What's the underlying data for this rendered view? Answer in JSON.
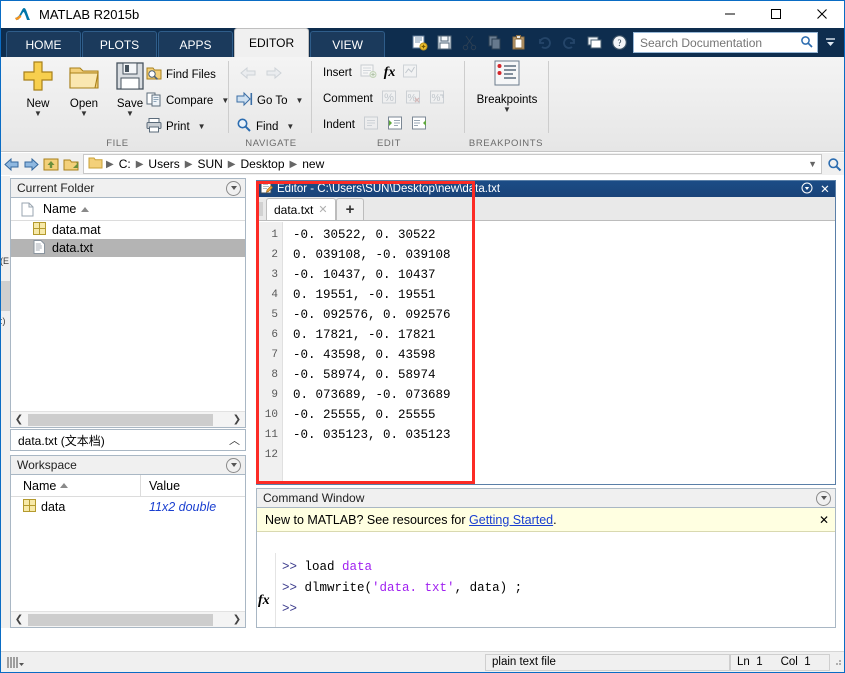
{
  "window": {
    "title": "MATLAB R2015b",
    "minimize": "—",
    "maximize": "☐",
    "close": "✕"
  },
  "ribbon": {
    "tabs": [
      {
        "label": "HOME",
        "active": false
      },
      {
        "label": "PLOTS",
        "active": false
      },
      {
        "label": "APPS",
        "active": false
      },
      {
        "label": "EDITOR",
        "active": true
      },
      {
        "label": "VIEW",
        "active": false
      }
    ],
    "quick_access": [
      {
        "name": "new-script-icon",
        "enabled": true
      },
      {
        "name": "save-icon",
        "enabled": true
      },
      {
        "name": "cut-icon",
        "enabled": false
      },
      {
        "name": "copy-icon",
        "enabled": false
      },
      {
        "name": "paste-icon",
        "enabled": true
      },
      {
        "name": "undo-icon",
        "enabled": false
      },
      {
        "name": "redo-icon",
        "enabled": false
      },
      {
        "name": "switch-window-icon",
        "enabled": true
      },
      {
        "name": "help-icon",
        "enabled": true
      }
    ],
    "search": {
      "placeholder": "Search Documentation",
      "value": ""
    },
    "groups": [
      {
        "name": "FILE",
        "label": "FILE",
        "big_buttons": [
          {
            "label": "New",
            "icon": "new-plus-icon",
            "has_caret": true
          },
          {
            "label": "Open",
            "icon": "open-folder-icon",
            "has_caret": true
          },
          {
            "label": "Save",
            "icon": "save-floppy-icon",
            "has_caret": true
          }
        ],
        "small_items": [
          {
            "label": "Find Files",
            "icon": "find-files-icon",
            "has_caret": false
          },
          {
            "label": "Compare",
            "icon": "compare-icon",
            "has_caret": true
          },
          {
            "label": "Print",
            "icon": "print-icon",
            "has_caret": true
          }
        ]
      },
      {
        "name": "NAVIGATE",
        "label": "NAVIGATE",
        "small_items": [
          {
            "label": "",
            "icon": "back-arrow-icon",
            "has_caret": false,
            "disabled": true
          },
          {
            "label": "",
            "icon": "forward-arrow-icon",
            "has_caret": false,
            "disabled": true
          },
          {
            "label": "Go To",
            "icon": "go-to-icon",
            "has_caret": true
          },
          {
            "label": "Find",
            "icon": "find-magnifier-icon",
            "has_caret": true
          }
        ]
      },
      {
        "name": "EDIT",
        "label": "EDIT",
        "rows": [
          {
            "label": "Insert",
            "icons": [
              "insert-icon",
              "function-fx-icon",
              "insert-block-icon"
            ]
          },
          {
            "label": "Comment",
            "icons": [
              "comment-percent-icon",
              "uncomment-icon",
              "wrap-comment-icon"
            ]
          },
          {
            "label": "Indent",
            "icons": [
              "indent-icon",
              "indent-right-icon",
              "indent-left-icon"
            ]
          }
        ]
      },
      {
        "name": "BREAKPOINTS",
        "label": "BREAKPOINTS",
        "big_buttons": [
          {
            "label": "Breakpoints",
            "icon": "breakpoints-icon",
            "has_caret": true
          }
        ]
      }
    ]
  },
  "addressbar": {
    "back": "back-arrow",
    "forward": "forward-arrow",
    "up": "up-folder",
    "browse": "browse-folder",
    "crumbs": [
      "C:",
      "Users",
      "SUN",
      "Desktop",
      "new"
    ],
    "dropdown": "▾",
    "search_icon": "search-magnifier"
  },
  "current_folder": {
    "title": "Current Folder",
    "columns": [
      "Name"
    ],
    "sort": "asc",
    "files": [
      {
        "name": "data.mat",
        "icon": "mat-file-icon",
        "selected": false
      },
      {
        "name": "data.txt",
        "icon": "txt-file-icon",
        "selected": true
      }
    ]
  },
  "details": {
    "label": "data.txt  (文本档)",
    "collapse": "⌃"
  },
  "workspace": {
    "title": "Workspace",
    "columns": [
      "Name",
      "Value"
    ],
    "rows": [
      {
        "name": "data",
        "value": "11x2 double",
        "icon": "matrix-icon"
      }
    ]
  },
  "editor": {
    "title": "Editor - C:\\Users\\SUN\\Desktop\\new\\data.txt",
    "tabs": [
      {
        "label": "data.txt",
        "closable": true
      }
    ],
    "new_tab": "+",
    "lines": [
      {
        "n": 1,
        "text": "-0. 30522, 0. 30522"
      },
      {
        "n": 2,
        "text": "0. 039108, -0. 039108"
      },
      {
        "n": 3,
        "text": "-0. 10437, 0. 10437"
      },
      {
        "n": 4,
        "text": "0. 19551, -0. 19551"
      },
      {
        "n": 5,
        "text": "-0. 092576, 0. 092576"
      },
      {
        "n": 6,
        "text": "0. 17821, -0. 17821"
      },
      {
        "n": 7,
        "text": "-0. 43598, 0. 43598"
      },
      {
        "n": 8,
        "text": "-0. 58974, 0. 58974"
      },
      {
        "n": 9,
        "text": "0. 073689, -0. 073689"
      },
      {
        "n": 10,
        "text": "-0. 25555, 0. 25555"
      },
      {
        "n": 11,
        "text": "-0. 035123, 0. 035123"
      },
      {
        "n": 12,
        "text": ""
      }
    ]
  },
  "command_window": {
    "title": "Command Window",
    "banner": {
      "prefix": "New to MATLAB? See resources for ",
      "link": "Getting Started",
      "suffix": ".",
      "close": "✕"
    },
    "entries": [
      {
        "prompt": ">>",
        "parts": [
          {
            "t": "load ",
            "c": "plain"
          },
          {
            "t": "data",
            "c": "kw"
          }
        ]
      },
      {
        "prompt": ">>",
        "parts": [
          {
            "t": "dlmwrite(",
            "c": "plain"
          },
          {
            "t": "'data. txt'",
            "c": "kw"
          },
          {
            "t": ", data) ;",
            "c": "plain"
          }
        ]
      },
      {
        "prompt": ">>",
        "parts": []
      }
    ],
    "fx_icon": "fx"
  },
  "statusbar": {
    "file_type": "plain text file",
    "ln_label": "Ln",
    "ln_value": "1",
    "col_label": "Col",
    "col_value": "1"
  },
  "colors": {
    "ribbon_tab_bg": "#1b3a5c",
    "ribbon_bar_bg": "#0e2d4e",
    "editor_title_bg": "#1b4c86",
    "accent_blue": "#1a3fd0",
    "banner_bg": "#ffffe1",
    "annotation_red": "#fc2b25",
    "selection_gray": "#b4b4b4"
  }
}
